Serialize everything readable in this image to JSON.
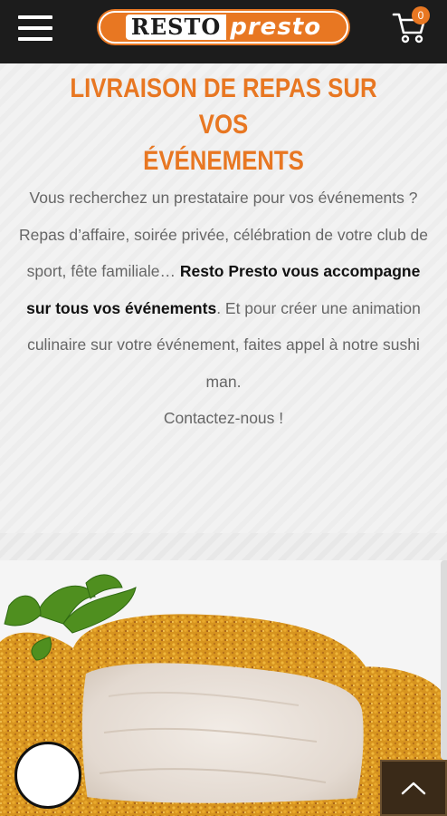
{
  "header": {
    "logo_part1": "RESTO",
    "logo_part2": "presto",
    "cart_count": "0",
    "menu_icon": "hamburger-menu-icon",
    "cart_icon": "shopping-cart-icon"
  },
  "main": {
    "title_line1": "LIVRAISON DE REPAS SUR VOS",
    "title_line2": "ÉVÉNEMENTS",
    "paragraph_part1": "Vous recherchez un prestataire pour vos événements ? Repas d’affaire, soirée privée, célébration de votre club de sport, fête familiale… ",
    "paragraph_bold": "Resto Presto vous accompagne sur tous vos événements",
    "paragraph_part2": ". Et pour créer une animation culinaire sur votre événement, faites appel à notre sushi man.",
    "contact": "Contactez-nous !"
  },
  "image": {
    "subject": "breaded-chicken-cutlet-with-parsley"
  },
  "floating": {
    "scroll_top_icon": "chevron-up-icon",
    "chat_icon": "chat-bubble-icon"
  },
  "colors": {
    "accent": "#e87722",
    "header_bg": "#1c1c1c",
    "text_muted": "#666666",
    "text_strong": "#111111"
  }
}
